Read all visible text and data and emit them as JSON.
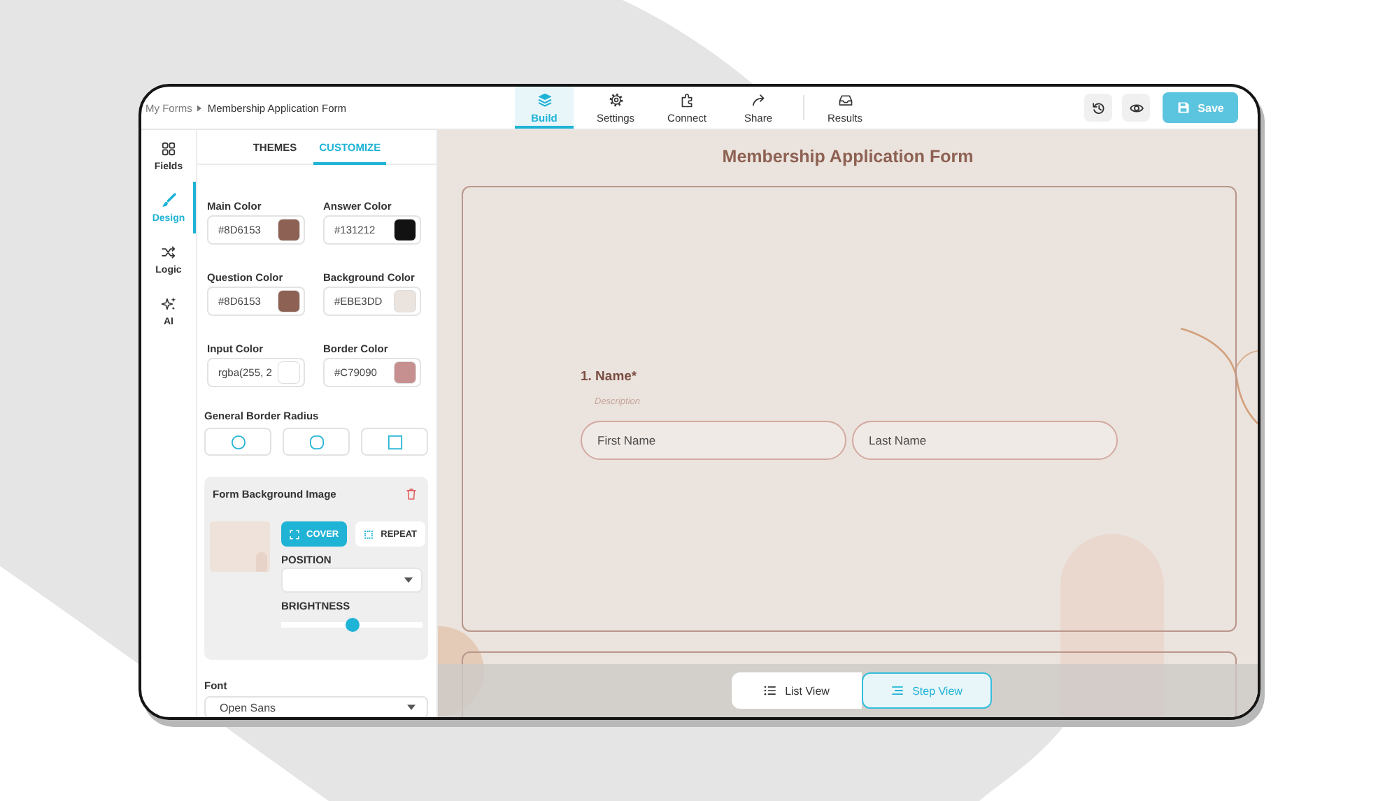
{
  "breadcrumb": {
    "items": [
      "My Forms",
      "Membership Application Form"
    ]
  },
  "nav": {
    "groups": [
      {
        "tabs": [
          {
            "label": "Build",
            "selected": true
          },
          {
            "label": "Settings",
            "selected": false
          },
          {
            "label": "Connect",
            "selected": false
          },
          {
            "label": "Share",
            "selected": false
          }
        ]
      },
      {
        "tabs": [
          {
            "label": "Results",
            "selected": false
          }
        ]
      }
    ]
  },
  "save_button": {
    "label": "Save"
  },
  "side_nav": [
    {
      "label": "Fields",
      "selected": false
    },
    {
      "label": "Design",
      "selected": true
    },
    {
      "label": "Logic",
      "selected": false
    },
    {
      "label": "AI",
      "selected": false
    }
  ],
  "design_panel": {
    "tabs": [
      {
        "label": "THEMES",
        "selected": false
      },
      {
        "label": "CUSTOMIZE",
        "selected": true
      }
    ],
    "colors": [
      {
        "label": "Main Color",
        "value": "#8D6153",
        "color": "#8d6153"
      },
      {
        "label": "Answer Color",
        "value": "#131212",
        "color": "#131212"
      },
      {
        "label": "Question Color",
        "value": "#8D6153",
        "color": "#8d6153"
      },
      {
        "label": "Background Color",
        "value": "#EBE3DD",
        "color": "#ebe3dd"
      },
      {
        "label": "Input Color",
        "value": "rgba(255, 2",
        "color": "#ffffff"
      },
      {
        "label": "Border Color",
        "value": "#C79090",
        "color": "#c79090"
      }
    ],
    "border_radius": {
      "label": "General Border Radius",
      "options": [
        {
          "kind": "circle"
        },
        {
          "kind": "rounded"
        },
        {
          "kind": "square"
        }
      ]
    },
    "background_image": {
      "title": "Form Background Image",
      "fit_options": [
        {
          "label": "COVER",
          "selected": true
        },
        {
          "label": "REPEAT",
          "selected": false
        }
      ],
      "position_label": "POSITION",
      "brightness_label": "BRIGHTNESS",
      "brightness": {
        "level": 0.5
      }
    },
    "font": {
      "label": "Font",
      "value": "Open Sans"
    }
  },
  "form": {
    "title": "Membership Application Form",
    "questions": [
      {
        "label": "1. Name*",
        "description": "Description",
        "inputs": [
          {
            "placeholder": "First Name"
          },
          {
            "placeholder": "Last Name"
          }
        ]
      }
    ]
  },
  "view_toggle": [
    {
      "label": "List View",
      "selected": false
    },
    {
      "label": "Step View",
      "selected": true
    }
  ]
}
